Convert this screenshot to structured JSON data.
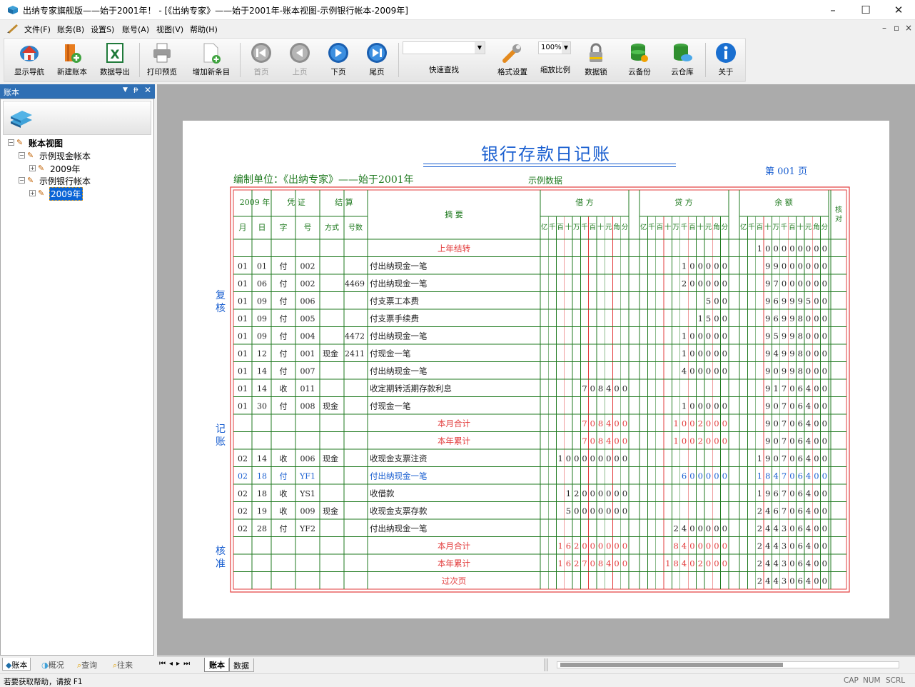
{
  "window": {
    "title": "出纳专家旗舰版——始于2001年！ - [《出纳专家》——始于2001年-账本视图-示例银行帐本-2009年]",
    "minimize": "–",
    "maximize": "☐",
    "close": "✕"
  },
  "menu": [
    "文件(F)",
    "账务(B)",
    "设置S)",
    "账号(A)",
    "视图(V)",
    "帮助(H)"
  ],
  "mdi_controls": [
    "–",
    "▫",
    "×"
  ],
  "toolbar": {
    "show_nav": "显示导航",
    "new_book": "新建账本",
    "export": "数据导出",
    "print_preview": "打印预览",
    "add_entry": "增加新条目",
    "first": "首页",
    "prev": "上页",
    "next": "下页",
    "last": "尾页",
    "quick_search": "快速查找",
    "format": "格式设置",
    "zoom_value": "100%",
    "zoom_label": "缩放比例",
    "lock": "数据锁",
    "cloud_backup": "云备份",
    "cloud_store": "云仓库",
    "about": "关于"
  },
  "left_panel": {
    "title": "账本",
    "tree": {
      "root": "账本视图",
      "cash_book": "示例现金帐本",
      "cash_year": "2009年",
      "bank_book": "示例银行帐本",
      "bank_year": "2009年"
    },
    "tabs": [
      "账本",
      "概况",
      "查询",
      "往来"
    ]
  },
  "ledger": {
    "title": "银行存款日记账",
    "unit_label": "编制单位：《出纳专家》——始于2001年",
    "sample": "示例数据",
    "page": "第 001 页",
    "side": {
      "review": "复核",
      "record": "记账",
      "approve": "核准"
    },
    "headers": {
      "year": "2009 年",
      "voucher": "凭  证",
      "settle": "结  算",
      "summary": "摘  要",
      "debit": "借  方",
      "credit": "贷  方",
      "balance": "余  额",
      "check": "核对",
      "month": "月",
      "day": "日",
      "zi": "字",
      "hao": "号",
      "method": "方式",
      "number": "号数",
      "digits": "亿千百十万千百十元角分"
    },
    "rows": [
      {
        "m": "",
        "d": "",
        "z": "",
        "h": "",
        "fs": "",
        "hs": "",
        "s": "上年结转",
        "dr": "",
        "cr": "",
        "bal": "100000000",
        "c": "red"
      },
      {
        "m": "01",
        "d": "01",
        "z": "付",
        "h": "002",
        "fs": "",
        "hs": "",
        "s": "付出纳现金一笔",
        "dr": "",
        "cr": "100000",
        "bal": "99000000",
        "c": ""
      },
      {
        "m": "01",
        "d": "06",
        "z": "付",
        "h": "002",
        "fs": "",
        "hs": "4469",
        "s": "付出纳现金一笔",
        "dr": "",
        "cr": "200000",
        "bal": "97000000",
        "c": ""
      },
      {
        "m": "01",
        "d": "09",
        "z": "付",
        "h": "006",
        "fs": "",
        "hs": "",
        "s": "付支票工本费",
        "dr": "",
        "cr": "500",
        "bal": "96999500",
        "c": ""
      },
      {
        "m": "01",
        "d": "09",
        "z": "付",
        "h": "005",
        "fs": "",
        "hs": "",
        "s": "付支票手续费",
        "dr": "",
        "cr": "1500",
        "bal": "96998000",
        "c": ""
      },
      {
        "m": "01",
        "d": "09",
        "z": "付",
        "h": "004",
        "fs": "",
        "hs": "4472",
        "s": "付出纳现金一笔",
        "dr": "",
        "cr": "100000",
        "bal": "95998000",
        "c": ""
      },
      {
        "m": "01",
        "d": "12",
        "z": "付",
        "h": "001",
        "fs": "现金",
        "hs": "2411",
        "s": "付现金一笔",
        "dr": "",
        "cr": "100000",
        "bal": "94998000",
        "c": ""
      },
      {
        "m": "01",
        "d": "14",
        "z": "付",
        "h": "007",
        "fs": "",
        "hs": "",
        "s": "付出纳现金一笔",
        "dr": "",
        "cr": "400000",
        "bal": "90998000",
        "c": ""
      },
      {
        "m": "01",
        "d": "14",
        "z": "收",
        "h": "011",
        "fs": "",
        "hs": "",
        "s": "收定期转活期存款利息",
        "dr": "708400",
        "cr": "",
        "bal": "91706400",
        "c": ""
      },
      {
        "m": "01",
        "d": "30",
        "z": "付",
        "h": "008",
        "fs": "现金",
        "hs": "",
        "s": "付现金一笔",
        "dr": "",
        "cr": "100000",
        "bal": "90706400",
        "c": ""
      },
      {
        "m": "",
        "d": "",
        "z": "",
        "h": "",
        "fs": "",
        "hs": "",
        "s": "本月合计",
        "dr": "708400",
        "cr": "1002000",
        "bal": "90706400",
        "c": "red"
      },
      {
        "m": "",
        "d": "",
        "z": "",
        "h": "",
        "fs": "",
        "hs": "",
        "s": "本年累计",
        "dr": "708400",
        "cr": "1002000",
        "bal": "90706400",
        "c": "red"
      },
      {
        "m": "02",
        "d": "14",
        "z": "收",
        "h": "006",
        "fs": "现金",
        "hs": "",
        "s": "收现金支票注资",
        "dr": "100000000",
        "cr": "",
        "bal": "190706400",
        "c": ""
      },
      {
        "m": "02",
        "d": "18",
        "z": "付",
        "h": "YF1",
        "fs": "",
        "hs": "",
        "s": "付出纳现金一笔",
        "dr": "",
        "cr": "600000",
        "bal": "184706400",
        "c": "blue"
      },
      {
        "m": "02",
        "d": "18",
        "z": "收",
        "h": "YS1",
        "fs": "",
        "hs": "",
        "s": "收借款",
        "dr": "12000000",
        "cr": "",
        "bal": "196706400",
        "c": ""
      },
      {
        "m": "02",
        "d": "19",
        "z": "收",
        "h": "009",
        "fs": "现金",
        "hs": "",
        "s": "收现金支票存款",
        "dr": "50000000",
        "cr": "",
        "bal": "246706400",
        "c": ""
      },
      {
        "m": "02",
        "d": "28",
        "z": "付",
        "h": "YF2",
        "fs": "",
        "hs": "",
        "s": "付出纳现金一笔",
        "dr": "",
        "cr": "2400000",
        "bal": "244306400",
        "c": ""
      },
      {
        "m": "",
        "d": "",
        "z": "",
        "h": "",
        "fs": "",
        "hs": "",
        "s": "本月合计",
        "dr": "162000000",
        "cr": "8400000",
        "bal": "244306400",
        "c": "red"
      },
      {
        "m": "",
        "d": "",
        "z": "",
        "h": "",
        "fs": "",
        "hs": "",
        "s": "本年累计",
        "dr": "162708400",
        "cr": "18402000",
        "bal": "244306400",
        "c": "red"
      },
      {
        "m": "",
        "d": "",
        "z": "",
        "h": "",
        "fs": "",
        "hs": "",
        "s": "过次页",
        "dr": "",
        "cr": "",
        "bal": "244306400",
        "c": "red"
      }
    ]
  },
  "sheet_tabs": [
    "账本",
    "数据"
  ],
  "sheet_nav": [
    "⏮",
    "◂",
    "▸",
    "⏭"
  ],
  "status": {
    "help": "若要获取帮助，请按 F1",
    "cap": "CAP",
    "num": "NUM",
    "scrl": "SCRL"
  },
  "colors": {
    "accent": "#2f6fb4",
    "ledger_red": "#e23b3b",
    "ledger_green": "#1f7a1f",
    "ledger_blue": "#1a5fd0"
  }
}
